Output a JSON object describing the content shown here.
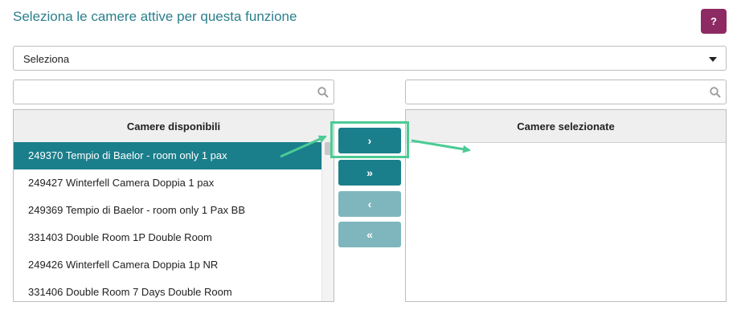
{
  "header": {
    "title": "Seleziona le camere attive per questa funzione",
    "help_label": "?"
  },
  "select": {
    "value": "Seleziona"
  },
  "search_left": {
    "placeholder": ""
  },
  "search_right": {
    "placeholder": ""
  },
  "available": {
    "header": "Camere disponibili",
    "items": [
      "249370 Tempio di Baelor - room only 1 pax",
      "249427 Winterfell Camera Doppia 1 pax",
      "249369 Tempio di Baelor - room only 1 Pax BB",
      "331403 Double Room 1P Double Room",
      "249426 Winterfell Camera Doppia 1p NR",
      "331406 Double Room 7 Days Double Room"
    ],
    "selected_index": 0
  },
  "selected": {
    "header": "Camere selezionate",
    "items": []
  },
  "transfer_buttons": {
    "move_one": "›",
    "move_all": "»",
    "remove_one": "‹",
    "remove_all": "«"
  },
  "colors": {
    "accent": "#1b7e8b",
    "accent_disabled": "#7fb6bd",
    "help_button": "#8e2a63",
    "annotation": "#4ccb95",
    "title": "#2a7f8c"
  }
}
